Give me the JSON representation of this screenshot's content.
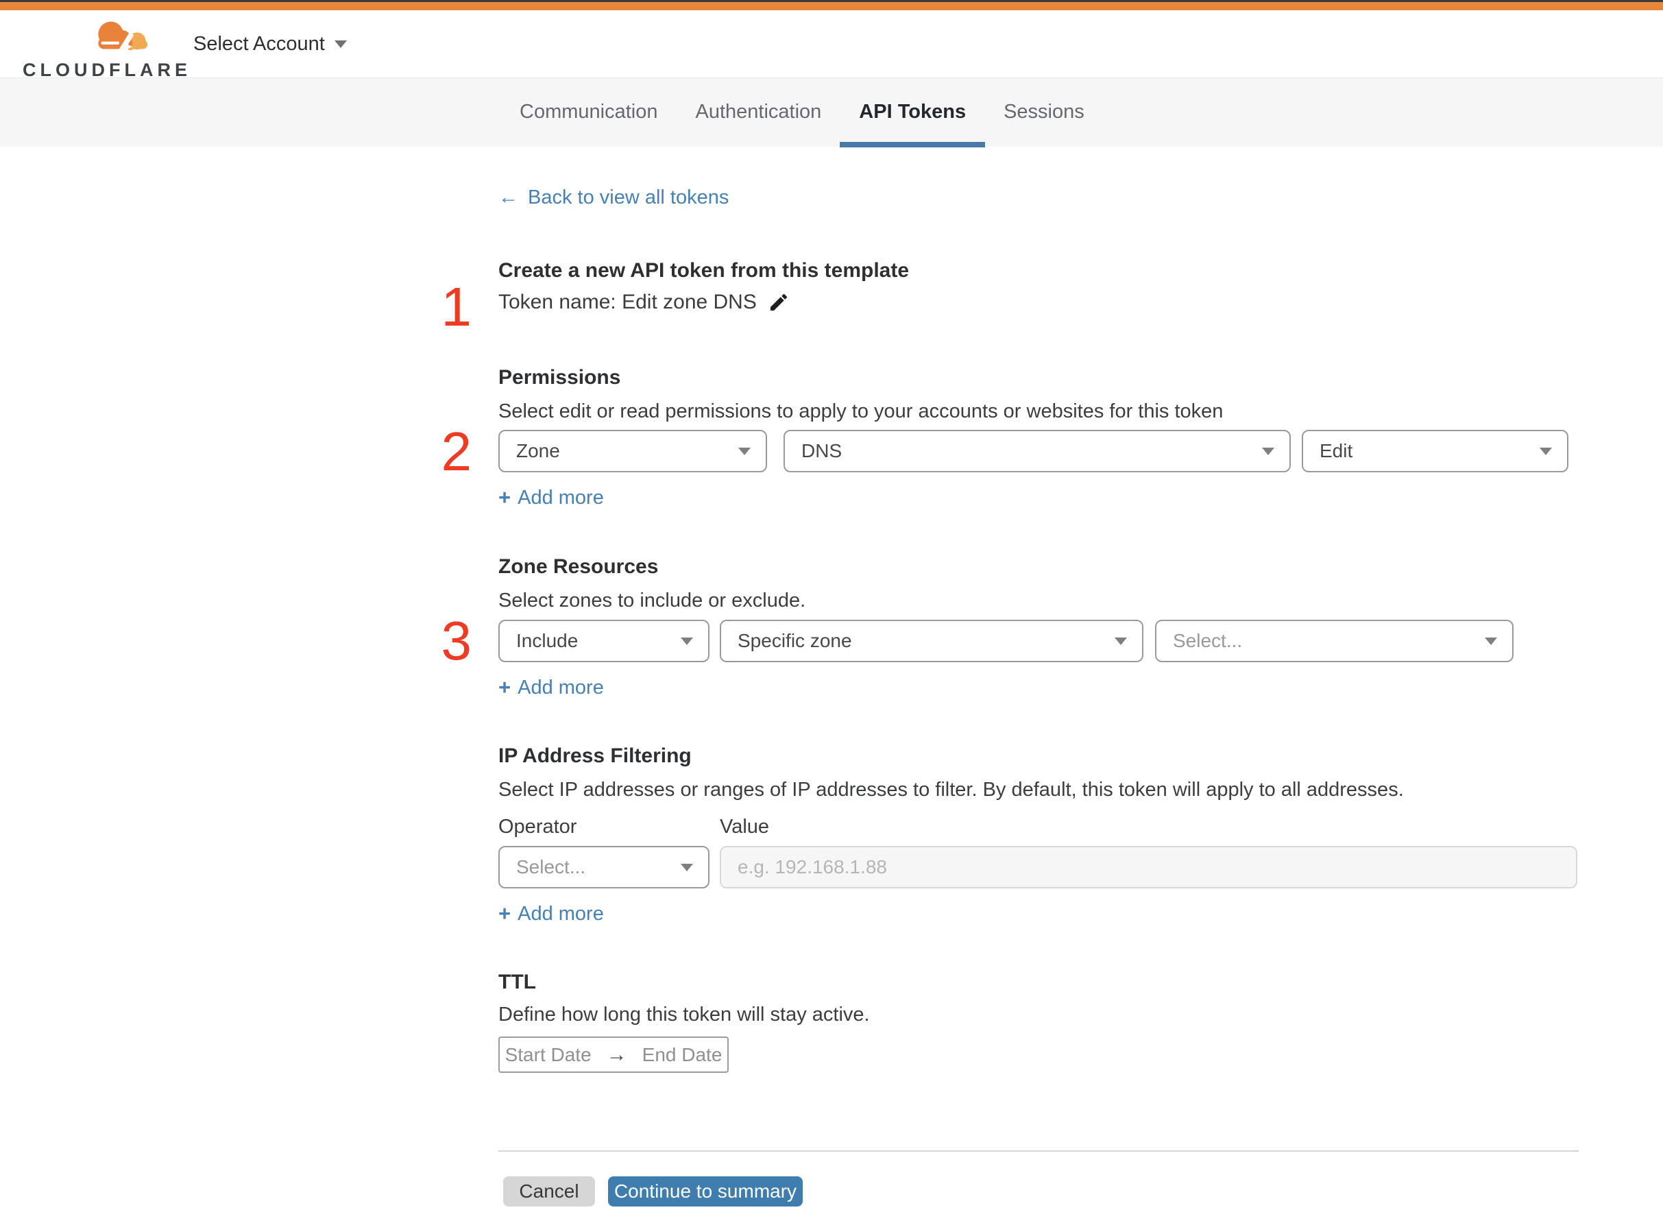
{
  "colors": {
    "top_bar_orange": "#e8863a",
    "top_bar_dark": "#3b3b3b",
    "accent_link_blue": "#4680b4",
    "tab_underline_blue": "#4a7aa8",
    "primary_button_blue": "#3f7dae",
    "step_number_red": "#ee3b23",
    "cancel_button_gray": "#d6d6d6",
    "tab_bar_background": "#f6f6f7"
  },
  "header": {
    "brand_wordmark": "CLOUDFLARE",
    "account_selector_label": "Select Account"
  },
  "tabs": {
    "items": [
      {
        "label": "Communication"
      },
      {
        "label": "Authentication"
      },
      {
        "label": "API Tokens"
      },
      {
        "label": "Sessions"
      }
    ],
    "active_label": "API Tokens"
  },
  "back_link": {
    "arrow_icon": "←",
    "label": "Back to view all tokens"
  },
  "steps": {
    "one": "1",
    "two": "2",
    "three": "3"
  },
  "token_template": {
    "title": "Create a new API token from this template",
    "token_name_line": "Token name: Edit zone DNS"
  },
  "permissions": {
    "title": "Permissions",
    "subtitle": "Select edit or read permissions to apply to your accounts or websites for this token",
    "scope_select_value": "Zone",
    "service_select_value": "DNS",
    "access_select_value": "Edit"
  },
  "zone_resources": {
    "title": "Zone Resources",
    "subtitle": "Select zones to include or exclude.",
    "mode_select_value": "Include",
    "type_select_value": "Specific zone",
    "zone_select_placeholder": "Select..."
  },
  "ip_filtering": {
    "title": "IP Address Filtering",
    "subtitle": "Select IP addresses or ranges of IP addresses to filter. By default, this token will apply to all addresses.",
    "operator_label": "Operator",
    "value_label": "Value",
    "operator_select_placeholder": "Select...",
    "value_placeholder": "e.g. 192.168.1.88"
  },
  "ttl": {
    "title": "TTL",
    "subtitle": "Define how long this token will stay active.",
    "start_date_label": "Start Date",
    "range_arrow_icon": "→",
    "end_date_label": "End Date"
  },
  "actions": {
    "plus_icon": "+",
    "add_more_label": "Add more",
    "cancel_label": "Cancel",
    "continue_label": "Continue to summary"
  }
}
